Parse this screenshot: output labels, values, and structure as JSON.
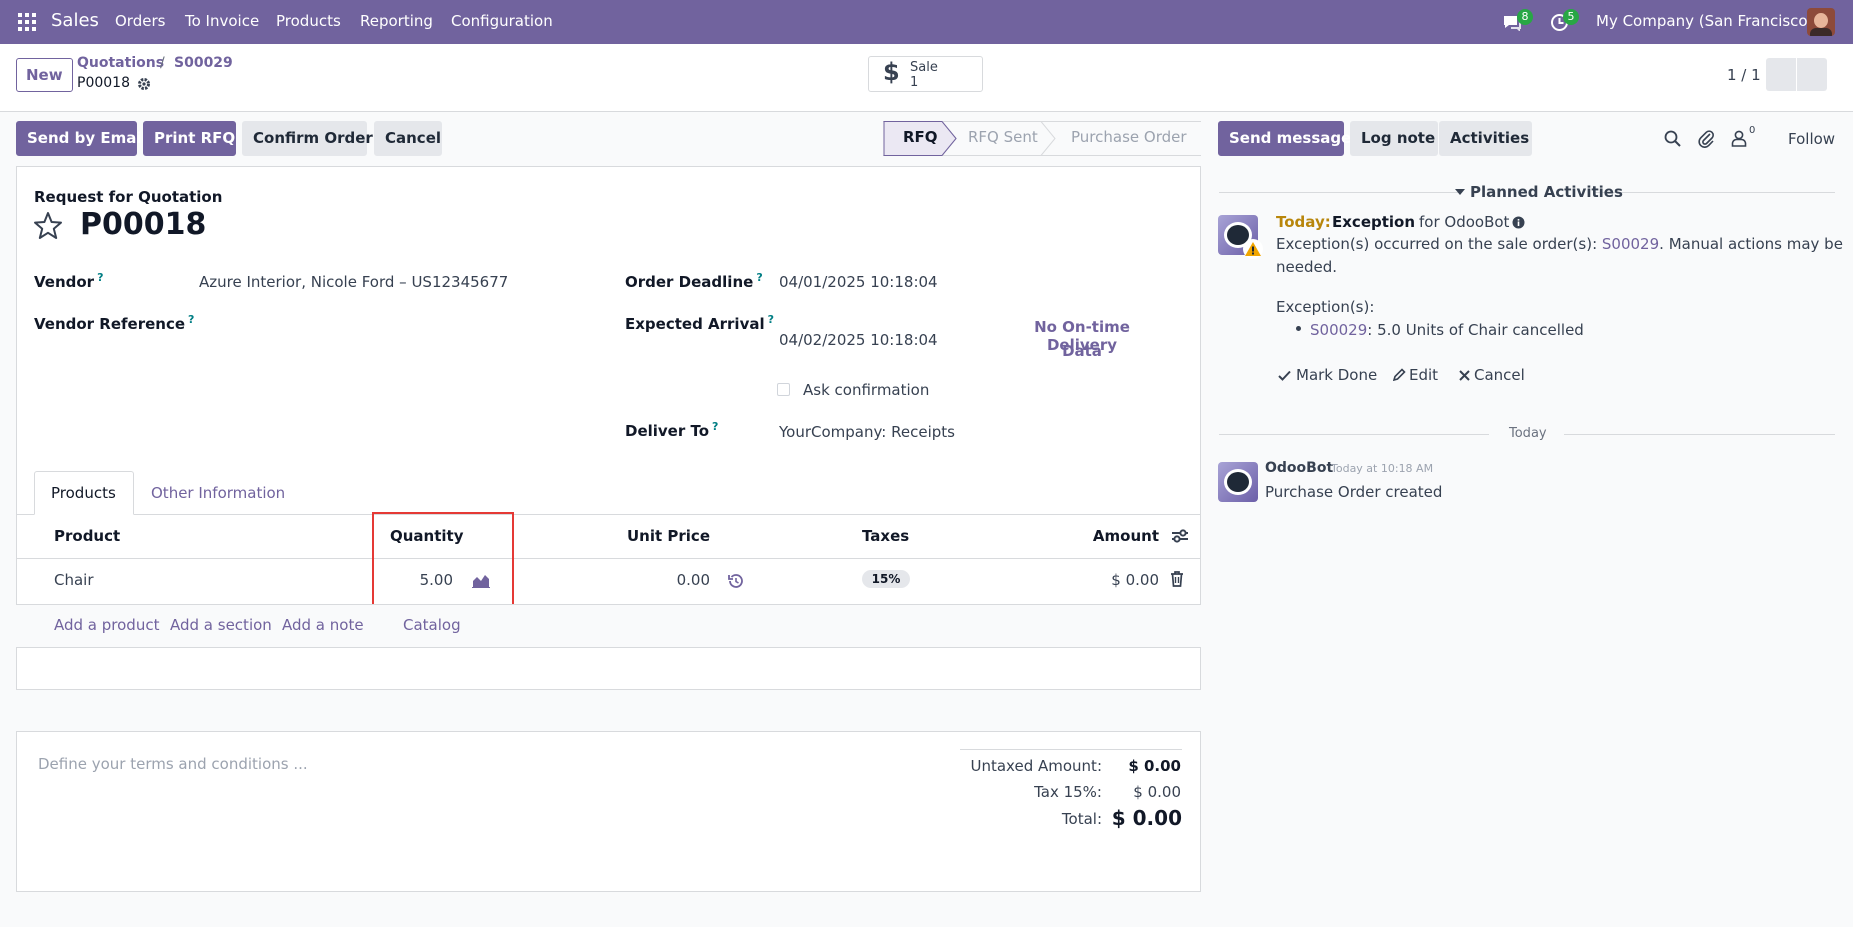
{
  "navbar": {
    "app": "Sales",
    "menu": [
      "Orders",
      "To Invoice",
      "Products",
      "Reporting",
      "Configuration"
    ],
    "messages_count": "8",
    "activities_count": "5",
    "company": "My Company (San Francisco)"
  },
  "control_panel": {
    "new_label": "New",
    "breadcrumb_1": "Quotations",
    "breadcrumb_sep": "/",
    "breadcrumb_2": "S00029",
    "record_name": "P00018",
    "smart_button_title": "Sale",
    "smart_button_count": "1",
    "pager": "1 / 1"
  },
  "actions": {
    "send_email": "Send by Email",
    "print_rfq": "Print RFQ",
    "confirm": "Confirm Order",
    "cancel": "Cancel"
  },
  "stages": [
    "RFQ",
    "RFQ Sent",
    "Purchase Order"
  ],
  "form": {
    "doc_type": "Request for Quotation",
    "number": "P00018",
    "vendor_label": "Vendor",
    "vendor_value": "Azure Interior, Nicole Ford – US12345677",
    "vendor_ref_label": "Vendor Reference",
    "order_deadline_label": "Order Deadline",
    "order_deadline_value": "04/01/2025 10:18:04",
    "expected_arrival_label": "Expected Arrival",
    "expected_arrival_value": "04/02/2025 10:18:04",
    "otd_line1": "No On-time Delivery",
    "otd_line2": "Data",
    "ask_confirmation": "Ask confirmation",
    "deliver_to_label": "Deliver To",
    "deliver_to_value": "YourCompany: Receipts",
    "q_mark": "?"
  },
  "tabs": [
    "Products",
    "Other Information"
  ],
  "lines": {
    "headers": {
      "product": "Product",
      "quantity": "Quantity",
      "unit_price": "Unit Price",
      "taxes": "Taxes",
      "amount": "Amount"
    },
    "rows": [
      {
        "product": "Chair",
        "quantity": "5.00",
        "unit_price": "0.00",
        "tax": "15%",
        "amount": "$ 0.00"
      }
    ],
    "add_product": "Add a product",
    "add_section": "Add a section",
    "add_note": "Add a note",
    "catalog": "Catalog"
  },
  "terms_placeholder": "Define your terms and conditions ...",
  "totals": {
    "untaxed_label": "Untaxed Amount:",
    "untaxed_value": "$ 0.00",
    "tax_label": "Tax 15%:",
    "tax_value": "$ 0.00",
    "total_label": "Total:",
    "total_value": "$ 0.00"
  },
  "chatter": {
    "send_message": "Send message",
    "log_note": "Log note",
    "activities": "Activities",
    "follower_count": "0",
    "follow": "Follow",
    "planned_activities": "Planned Activities",
    "activity": {
      "today": "Today:",
      "type": "Exception",
      "for": "for OdooBot",
      "text1a": "Exception(s) occurred on the sale order(s): ",
      "text1_link": "S00029",
      "text1b": ". Manual actions may be",
      "text2": "needed.",
      "exceptions_label": "Exception(s):",
      "bullet_link": "S00029",
      "bullet_text": ": 5.0 Units of Chair cancelled",
      "mark_done": "Mark Done",
      "edit": "Edit",
      "cancel": "Cancel"
    },
    "today_sep": "Today",
    "message": {
      "author": "OdooBot",
      "time": "Today at 10:18 AM",
      "body": "Purchase Order created"
    }
  },
  "colors": {
    "brand": "#71639e",
    "highlight": "#e53935",
    "badge": "#28a745"
  }
}
